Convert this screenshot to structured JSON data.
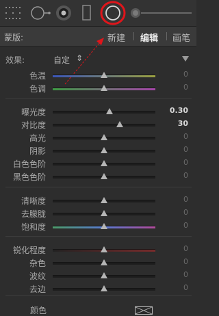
{
  "mask": {
    "label": "蒙版:",
    "modes": [
      "新建",
      "编辑",
      "画笔"
    ],
    "active_mode": "编辑"
  },
  "effect": {
    "label": "效果:",
    "preset": "自定",
    "stepper_symbol": "⇕"
  },
  "sliders": [
    {
      "label": "色温",
      "value": "0",
      "pos": 0.5,
      "track": "temp"
    },
    {
      "label": "色调",
      "value": "0",
      "pos": 0.5,
      "track": "tint"
    },
    {
      "label": "曝光度",
      "value": "0.30",
      "pos": 0.55,
      "track": "plain",
      "highlight": true
    },
    {
      "label": "对比度",
      "value": "30",
      "pos": 0.65,
      "track": "plain",
      "highlight": true
    },
    {
      "label": "高光",
      "value": "0",
      "pos": 0.5,
      "track": "plain"
    },
    {
      "label": "阴影",
      "value": "0",
      "pos": 0.5,
      "track": "plain"
    },
    {
      "label": "白色色阶",
      "value": "0",
      "pos": 0.5,
      "track": "plain"
    },
    {
      "label": "黑色色阶",
      "value": "0",
      "pos": 0.5,
      "track": "plain"
    },
    {
      "label": "清晰度",
      "value": "0",
      "pos": 0.5,
      "track": "plain"
    },
    {
      "label": "去朦胧",
      "value": "0",
      "pos": 0.5,
      "track": "plain"
    },
    {
      "label": "饱和度",
      "value": "0",
      "pos": 0.5,
      "track": "sat"
    },
    {
      "label": "锐化程度",
      "value": "0",
      "pos": 0.5,
      "track": "sharp"
    },
    {
      "label": "杂色",
      "value": "0",
      "pos": 0.5,
      "track": "plain"
    },
    {
      "label": "波纹",
      "value": "0",
      "pos": 0.5,
      "track": "plain"
    },
    {
      "label": "去边",
      "value": "0",
      "pos": 0.5,
      "track": "plain"
    }
  ],
  "color": {
    "label": "颜色"
  },
  "toolbar": {
    "highlight_color": "#e0151b"
  }
}
